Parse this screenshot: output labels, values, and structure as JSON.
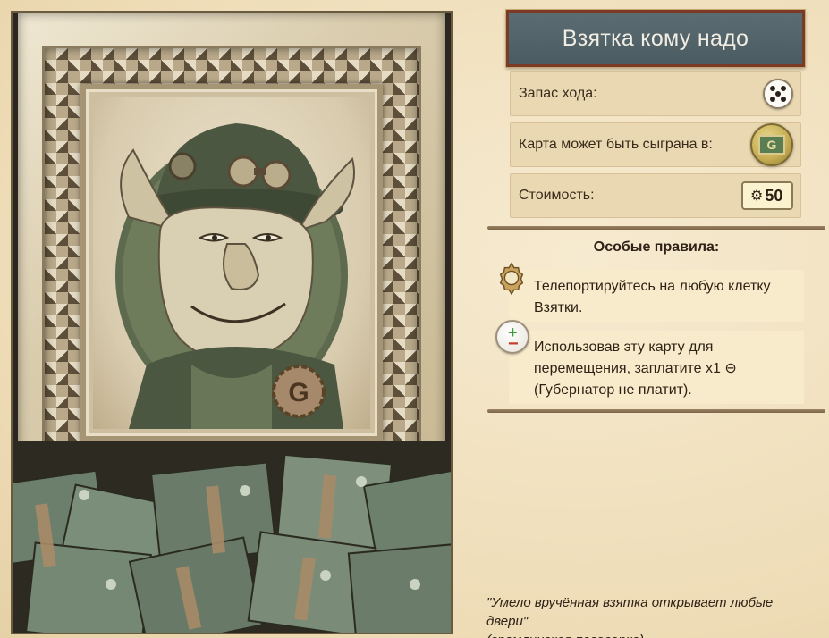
{
  "card": {
    "title": "Взятка кому надо",
    "stats": {
      "move_label": "Запас хода:",
      "play_label": "Карта может быть сыграна в:",
      "cost_label": "Стоимость:",
      "cost_value": "50",
      "cost_icon": "G"
    },
    "special_rules": {
      "heading": "Особые правила:",
      "rule1": "Телепортируйтесь на любую клетку Взятки.",
      "rule2": "Использовав эту карту для перемещения, заплатите x1 ⊖ (Губернатор не платит)."
    },
    "quote_line1": "\"Умело вручённая взятка открывает любые двери\"",
    "quote_line2": "(гремлинская поговорка).",
    "icons": {
      "move": "dice-icon",
      "play_location": "coin-location-icon",
      "rule1": "gear-icon",
      "rule2": "plus-minus-icon"
    },
    "colors": {
      "title_bg": "#4f6067",
      "title_border": "#7a3a25",
      "panel_bg": "#f1e3c3"
    }
  }
}
